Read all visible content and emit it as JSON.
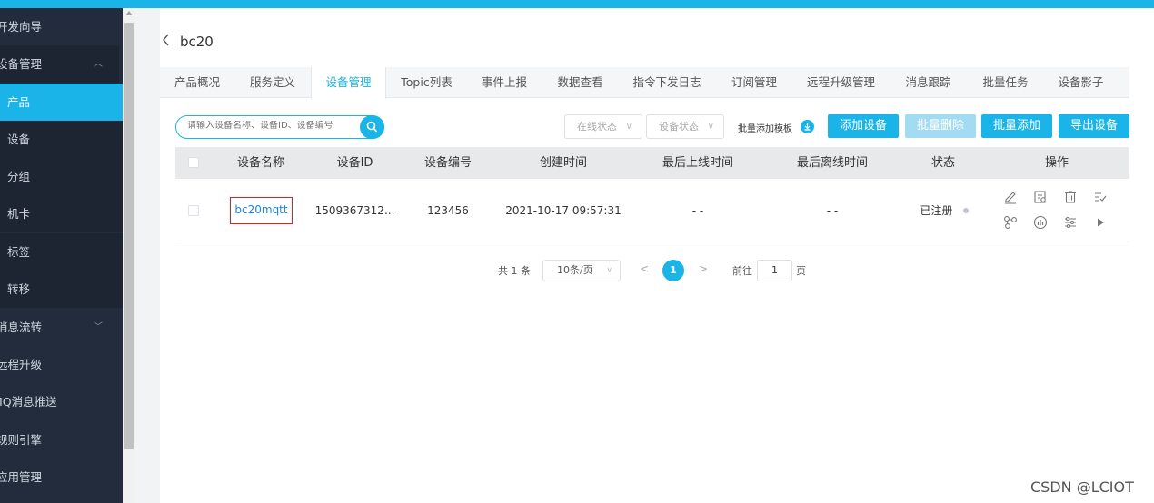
{
  "sidebar": {
    "items": [
      {
        "label": "开发向导"
      },
      {
        "label": "设备管理"
      },
      {
        "label": "产品"
      },
      {
        "label": "设备"
      },
      {
        "label": "分组"
      },
      {
        "label": "机卡"
      },
      {
        "label": "标签"
      },
      {
        "label": "转移"
      },
      {
        "label": "消息流转"
      },
      {
        "label": "远程升级"
      },
      {
        "label": "MQ消息推送"
      },
      {
        "label": "规则引擎"
      },
      {
        "label": "应用管理"
      }
    ],
    "active": "产品"
  },
  "page": {
    "back_icon": "chevron-left-icon",
    "title": "bc20"
  },
  "tabs": [
    {
      "label": "产品概况"
    },
    {
      "label": "服务定义"
    },
    {
      "label": "设备管理"
    },
    {
      "label": "Topic列表"
    },
    {
      "label": "事件上报"
    },
    {
      "label": "数据查看"
    },
    {
      "label": "指令下发日志"
    },
    {
      "label": "订阅管理"
    },
    {
      "label": "远程升级管理"
    },
    {
      "label": "消息跟踪"
    },
    {
      "label": "批量任务"
    },
    {
      "label": "设备影子"
    }
  ],
  "active_tab": "设备管理",
  "toolbar": {
    "search_placeholder": "请输入设备名称、设备ID、设备编号",
    "online_status": "在线状态",
    "device_status": "设备状态",
    "template_link": "批量添加模板",
    "add_device": "添加设备",
    "batch_delete": "批量删除",
    "batch_add": "批量添加",
    "export_devices": "导出设备"
  },
  "table": {
    "headers": [
      "设备名称",
      "设备ID",
      "设备编号",
      "创建时间",
      "最后上线时间",
      "最后离线时间",
      "状态",
      "操作"
    ],
    "rows": [
      {
        "name": "bc20mqtt",
        "device_id": "1509367312...",
        "device_no": "123456",
        "created": "2021-10-17 09:57:31",
        "last_online": "- -",
        "last_offline": "- -",
        "status": "已注册"
      }
    ]
  },
  "pagination": {
    "total": "共 1 条",
    "page_size": "10条/页",
    "current_page": "1",
    "goto_label": "前往",
    "goto_value": "1",
    "goto_suffix": "页"
  },
  "colors": {
    "accent": "#1bb4e8",
    "sidebar_bg": "#222c3c",
    "highlight_border": "#e02020"
  },
  "watermark": "CSDN @LCIOT"
}
